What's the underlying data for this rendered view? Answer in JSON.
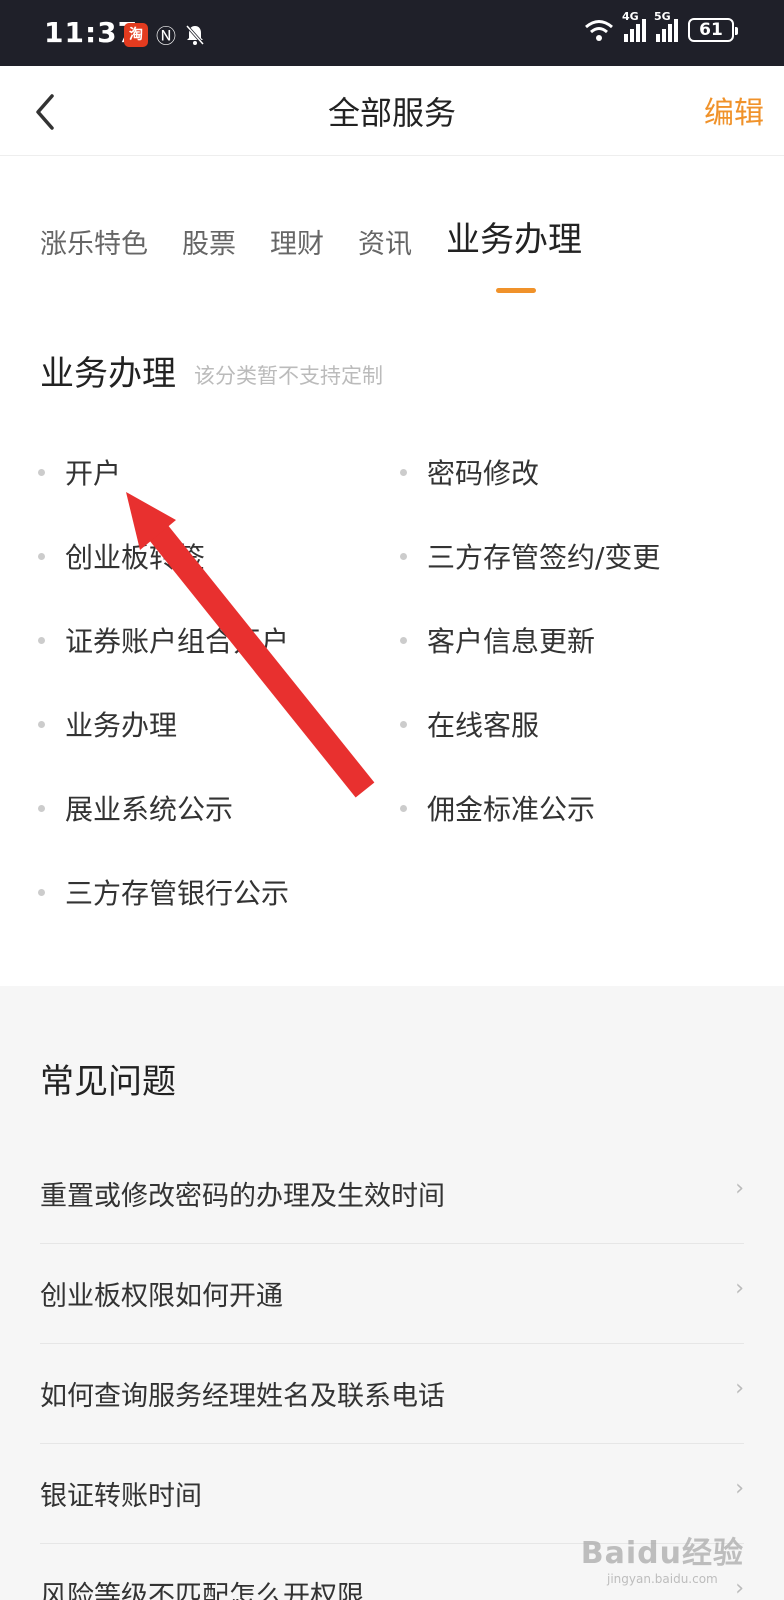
{
  "status_bar": {
    "time": "11:37",
    "battery": "61",
    "signal_labels": [
      "4G",
      "5G"
    ],
    "app_badge": "淘"
  },
  "nav": {
    "title": "全部服务",
    "edit_label": "编辑"
  },
  "tabs": [
    {
      "label": "涨乐特色",
      "active": false
    },
    {
      "label": "股票",
      "active": false
    },
    {
      "label": "理财",
      "active": false
    },
    {
      "label": "资讯",
      "active": false
    },
    {
      "label": "业务办理",
      "active": true
    }
  ],
  "section": {
    "title": "业务办理",
    "note": "该分类暂不支持定制"
  },
  "services": {
    "left": [
      "开户",
      "创业板转签",
      "证券账户组合开户",
      "业务办理",
      "展业系统公示",
      "三方存管银行公示"
    ],
    "right": [
      "密码修改",
      "三方存管签约/变更",
      "客户信息更新",
      "在线客服",
      "佣金标准公示"
    ]
  },
  "faq": {
    "title": "常见问题",
    "items": [
      "重置或修改密码的办理及生效时间",
      "创业板权限如何开通",
      "如何查询服务经理姓名及联系电话",
      "银证转账时间",
      "风险等级不匹配怎么开权限"
    ]
  },
  "watermark": {
    "brand": "Baidu经验",
    "url": "jingyan.baidu.com"
  },
  "colors": {
    "accent": "#f0922a",
    "annotation_arrow": "#e8302f"
  }
}
